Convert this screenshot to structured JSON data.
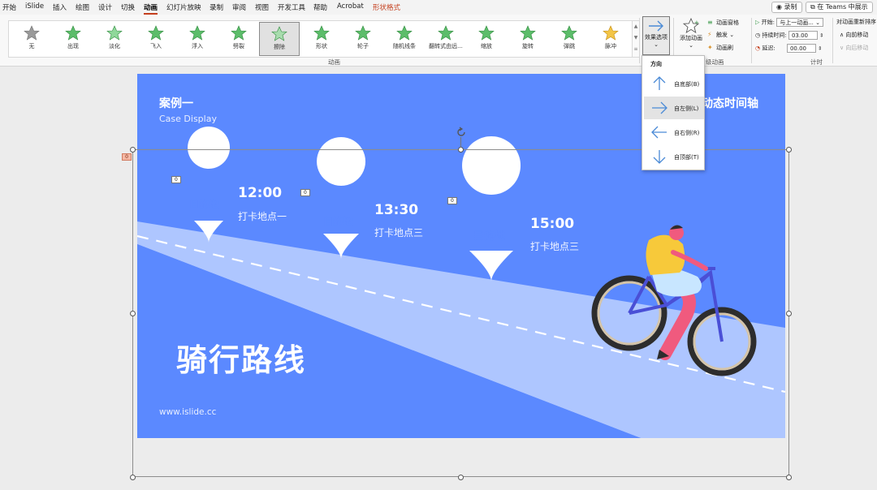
{
  "menu": {
    "tabs": [
      "开始",
      "iSlide",
      "插入",
      "绘图",
      "设计",
      "切换",
      "动画",
      "幻灯片放映",
      "录制",
      "审阅",
      "视图",
      "开发工具",
      "帮助",
      "Acrobat",
      "形状格式"
    ],
    "active_tab": "动画",
    "record_button": "录制",
    "teams_button": "在 Teams 中展示"
  },
  "ribbon": {
    "animations": [
      "无",
      "出现",
      "淡化",
      "飞入",
      "浮入",
      "劈裂",
      "擦除",
      "形状",
      "轮子",
      "随机线条",
      "翻转式由远...",
      "缩放",
      "旋转",
      "弹跳",
      "脉冲"
    ],
    "selected_animation": "擦除",
    "group_animation_label": "动画",
    "effect_options_label": "效果选项",
    "add_animation_label": "添加动画",
    "animation_pane": "动画窗格",
    "trigger": "触发",
    "animation_painter": "动画刷",
    "advanced_group_label": "级动画",
    "timing": {
      "start_label": "开始:",
      "start_value": "与上一动画...",
      "duration_label": "持续时间:",
      "duration_value": "03.00",
      "delay_label": "延迟:",
      "delay_value": "00.00",
      "group_label": "计时"
    },
    "reorder": {
      "title": "对动画重新排序",
      "move_earlier": "向前移动",
      "move_later": "向后移动"
    }
  },
  "dropdown": {
    "header": "方向",
    "items": [
      "自底部(B)",
      "自左侧(L)",
      "自右侧(R)",
      "自顶部(T)"
    ],
    "selected": "自左侧(L)"
  },
  "slide": {
    "case_title": "案例一",
    "case_subtitle": "Case Display",
    "right_title": "动态时间轴",
    "big_title": "骑行路线",
    "website": "www.islide.cc",
    "stops": [
      {
        "pin": "目的地",
        "time": "12:00",
        "place": "打卡地点一",
        "tag": "0"
      },
      {
        "pin": "目的地",
        "time": "13:30",
        "place": "打卡地点三",
        "tag": "0"
      },
      {
        "pin": "目的地",
        "time": "15:00",
        "place": "打卡地点三",
        "tag": "0"
      }
    ],
    "selection_tag": "0"
  },
  "colors": {
    "slide_bg": "#5b89ff",
    "road": "#aec6ff",
    "accent_tab": "#c43e1c",
    "shape_format_tab": "#c43e1c"
  }
}
